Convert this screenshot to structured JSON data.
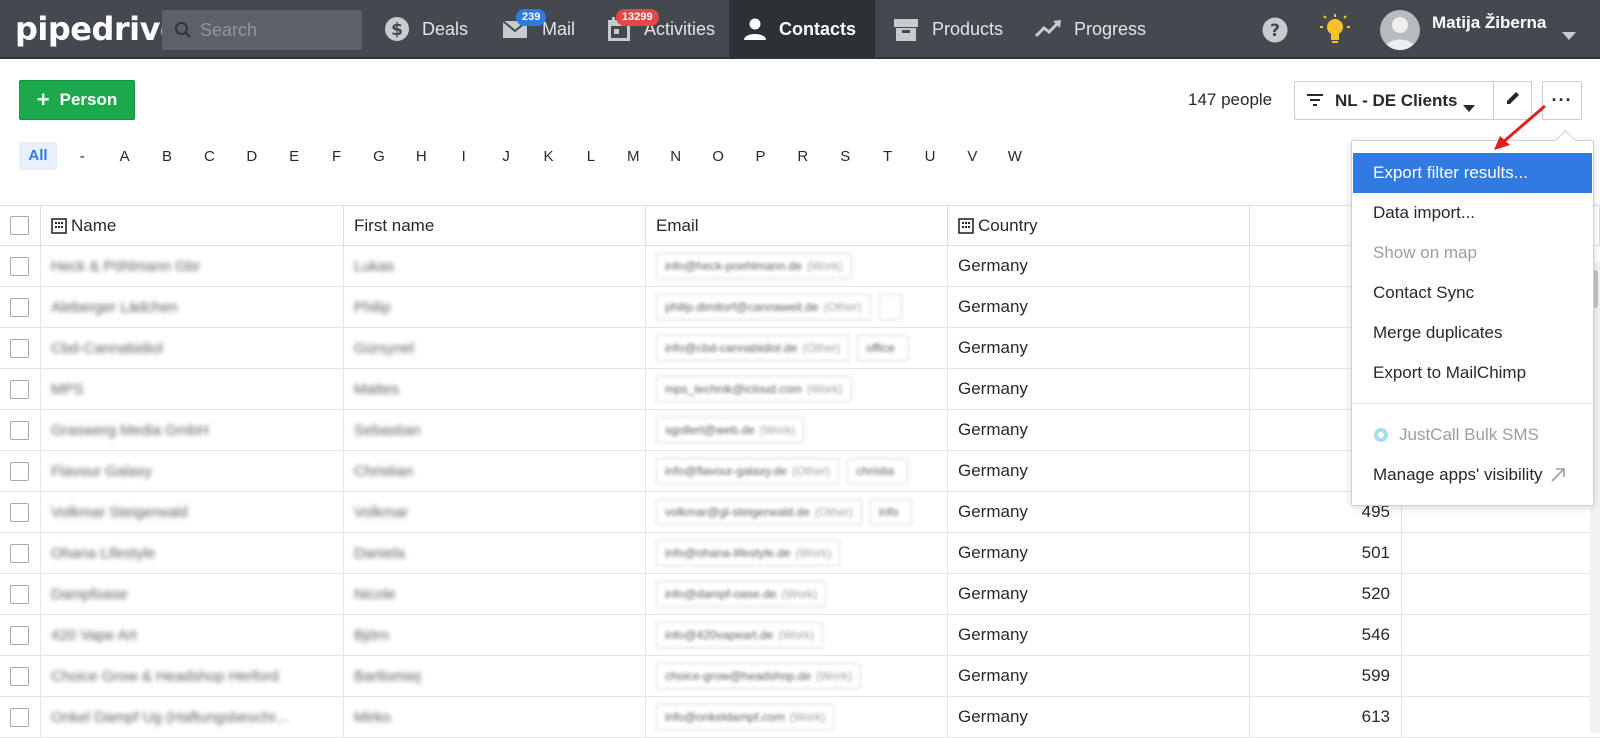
{
  "nav": {
    "logo": "pipedrive",
    "search_placeholder": "Search",
    "items": [
      {
        "label": "Deals",
        "icon": "dollar-icon"
      },
      {
        "label": "Mail",
        "icon": "mail-icon",
        "badge": "239"
      },
      {
        "label": "Activities",
        "icon": "calendar-icon",
        "badge": "13299"
      },
      {
        "label": "Contacts",
        "icon": "person-icon",
        "active": true
      },
      {
        "label": "Products",
        "icon": "box-icon"
      },
      {
        "label": "Progress",
        "icon": "trend-icon"
      }
    ],
    "user_name": "Matija Žiberna",
    "colors": {
      "nav_bg": "#43494e",
      "active_bg": "#2d3135",
      "badge_blue": "#317ae2",
      "badge_red": "#e3474a",
      "bulb": "#f6c12b"
    }
  },
  "toolbar": {
    "add_label": "Person",
    "count": "147 people",
    "filter_label": "NL - DE Clients",
    "more_label": "···",
    "add_color": "#1ca94c"
  },
  "alphabet": [
    "All",
    "-",
    "A",
    "B",
    "C",
    "D",
    "E",
    "F",
    "G",
    "H",
    "I",
    "J",
    "K",
    "L",
    "M",
    "N",
    "O",
    "P",
    "R",
    "S",
    "T",
    "U",
    "V",
    "W"
  ],
  "table": {
    "columns": [
      "Name",
      "First name",
      "Email",
      "Country",
      ""
    ],
    "rows": [
      {
        "name": "Heck & Pöhlmann Gbr",
        "first": "Lukas",
        "emails": [
          {
            "addr": "info@heck-poehlmann.de",
            "type": "(Work)"
          }
        ],
        "country": "Germany",
        "num": ""
      },
      {
        "name": "Aleberger Lädchen",
        "first": "Philip",
        "emails": [
          {
            "addr": "philip.dimitorf@cannaweit.de",
            "type": "(Other)"
          },
          {
            "addr": "",
            "type": ""
          }
        ],
        "country": "Germany",
        "num": ""
      },
      {
        "name": "Cbd-Cannabidiol",
        "first": "Gürsynel",
        "emails": [
          {
            "addr": "info@cbd-cannabidiol.de",
            "type": "(Other)"
          },
          {
            "addr": "office",
            "type": ""
          }
        ],
        "country": "Germany",
        "num": ""
      },
      {
        "name": "MPS",
        "first": "Mattes",
        "emails": [
          {
            "addr": "mps_technik@icloud.com",
            "type": "(Work)"
          }
        ],
        "country": "Germany",
        "num": ""
      },
      {
        "name": "Graswerg Media GmbH",
        "first": "Sebastian",
        "emails": [
          {
            "addr": "sgollert@web.de",
            "type": "(Work)"
          }
        ],
        "country": "Germany",
        "num": ""
      },
      {
        "name": "Flavour Galaxy",
        "first": "Christian",
        "emails": [
          {
            "addr": "info@flavour-galaxy.de",
            "type": "(Other)"
          },
          {
            "addr": "christia",
            "type": ""
          }
        ],
        "country": "Germany",
        "num": ""
      },
      {
        "name": "Volkmar Steigerwald",
        "first": "Volkmar",
        "emails": [
          {
            "addr": "volkmar@gl-steigerwald.de",
            "type": "(Other)"
          },
          {
            "addr": "info",
            "type": ""
          }
        ],
        "country": "Germany",
        "num": "495"
      },
      {
        "name": "Ohana Lifestyle",
        "first": "Daniela",
        "emails": [
          {
            "addr": "info@ohana-lifestyle.de",
            "type": "(Work)"
          }
        ],
        "country": "Germany",
        "num": "501"
      },
      {
        "name": "Dampfoase",
        "first": "Nicole",
        "emails": [
          {
            "addr": "info@dampf-oase.de",
            "type": "(Work)"
          }
        ],
        "country": "Germany",
        "num": "520"
      },
      {
        "name": "420 Vape Art",
        "first": "Björn",
        "emails": [
          {
            "addr": "info@420vapeart.de",
            "type": "(Work)"
          }
        ],
        "country": "Germany",
        "num": "546"
      },
      {
        "name": "Choice Grow & Headshop Herford",
        "first": "Bartlomiej",
        "emails": [
          {
            "addr": "choice-grow@headshop.de",
            "type": "(Work)"
          }
        ],
        "country": "Germany",
        "num": "599"
      },
      {
        "name": "Onkel Dampf Ug (Haftungsbeschr...",
        "first": "Mirko",
        "emails": [
          {
            "addr": "info@onkeldampf.com",
            "type": "(Work)"
          }
        ],
        "country": "Germany",
        "num": "613"
      }
    ]
  },
  "menu": {
    "items": [
      {
        "label": "Export filter results...",
        "state": "highlighted"
      },
      {
        "label": "Data import...",
        "state": "normal"
      },
      {
        "label": "Show on map",
        "state": "disabled"
      },
      {
        "label": "Contact Sync",
        "state": "normal"
      },
      {
        "label": "Merge duplicates",
        "state": "normal"
      },
      {
        "label": "Export to MailChimp",
        "state": "normal"
      },
      {
        "label": "JustCall Bulk SMS",
        "state": "disabled"
      },
      {
        "label": "Manage apps' visibility",
        "state": "normal"
      }
    ]
  }
}
